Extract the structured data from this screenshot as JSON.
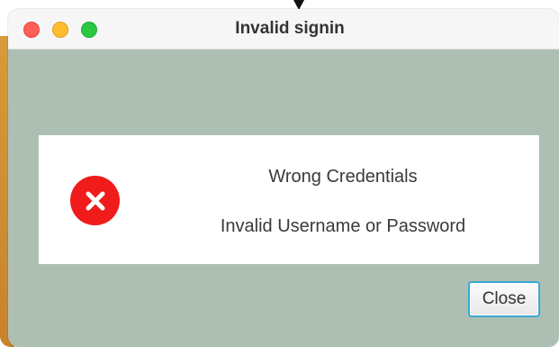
{
  "window": {
    "title": "Invalid signin",
    "controls": {
      "close": "close-window-control",
      "minimize": "minimize-window-control",
      "maximize": "maximize-window-control"
    }
  },
  "dialog": {
    "icon": "error-x-icon",
    "heading": "Wrong Credentials",
    "message": "Invalid Username or Password",
    "close_button_label": "Close"
  },
  "colors": {
    "window_background": "#adbfb3",
    "panel_background": "#ffffff",
    "error_icon": "#f01b1b",
    "button_focus_ring": "#38a9d6",
    "traffic_close": "#fe5f57",
    "traffic_minimize": "#febc2e",
    "traffic_maximize": "#28c840"
  }
}
